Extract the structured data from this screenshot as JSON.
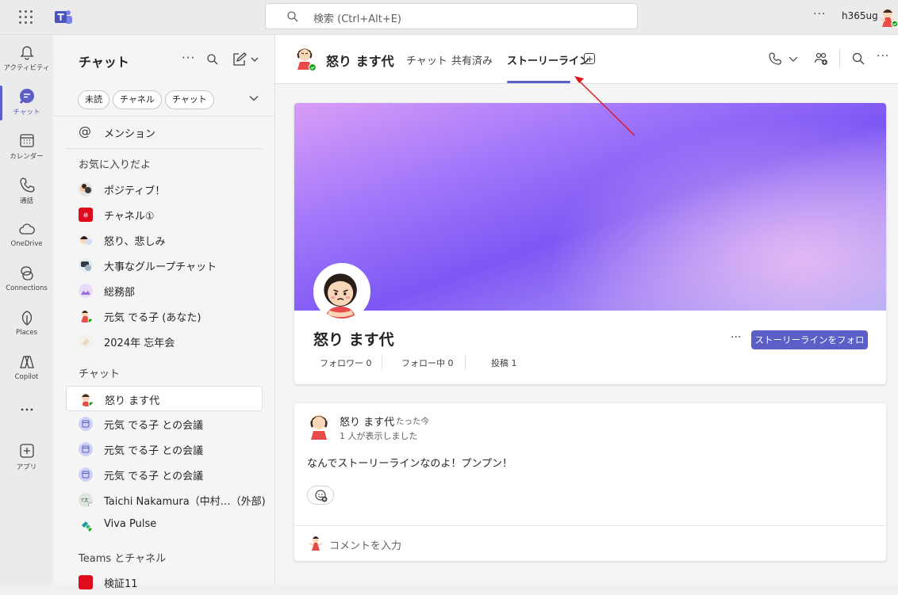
{
  "topbar": {
    "search_placeholder": "検索 (Ctrl+Alt+E)",
    "more": "···",
    "username": "h365ug"
  },
  "rail": [
    {
      "label": "アクティビティ",
      "icon": "bell-icon"
    },
    {
      "label": "チャット",
      "icon": "chat-icon",
      "active": true
    },
    {
      "label": "カレンダー",
      "icon": "calendar-icon"
    },
    {
      "label": "通話",
      "icon": "phone-icon"
    },
    {
      "label": "OneDrive",
      "icon": "cloud-icon"
    },
    {
      "label": "Connections",
      "icon": "connections-icon"
    },
    {
      "label": "Places",
      "icon": "places-icon"
    },
    {
      "label": "Copilot",
      "icon": "copilot-icon"
    },
    {
      "label": "",
      "icon": "more-apps-icon"
    },
    {
      "label": "アプリ",
      "icon": "add-app-icon"
    }
  ],
  "panel": {
    "title": "チャット",
    "filters": [
      "未読",
      "チャネル",
      "チャット"
    ],
    "mention": "メンション",
    "favorites_header": "お気に入りだよ",
    "favorites": [
      "ポジティブ！",
      "チャネル①",
      "怒り、悲しみ",
      "大事なグループチャット",
      "総務部",
      "元気 でる子 (あなた)",
      "2024年 忘年会"
    ],
    "chats_header": "チャット",
    "chats": [
      "怒り ます代",
      "元気 でる子 との会議",
      "元気 でる子 との会議",
      "元気 でる子 との会議",
      "Taichi Nakamura（中村…（外部)",
      "Viva Pulse"
    ],
    "teams_header": "Teams とチャネル",
    "teams": [
      "検証11"
    ]
  },
  "main": {
    "name": "怒り ます代",
    "tabs": [
      "チャット",
      "共有済み",
      "ストーリーライン"
    ],
    "active_tab": "ストーリーライン",
    "storyline": {
      "name": "怒り ます代",
      "followers": "フォロワー 0",
      "following": "フォロー中 0",
      "posts": "投稿 1",
      "more": "···",
      "follow_button": "ストーリーラインをフォローする"
    },
    "post": {
      "author": "怒り ます代",
      "time": "たった今",
      "views": "1 人が表示しました",
      "body": "なんでストーリーラインなのよ！プンプン！"
    },
    "comment_placeholder": "コメントを入力"
  },
  "colors": {
    "accent": "#5b5fc7",
    "annotation_arrow": "#e0141e"
  }
}
